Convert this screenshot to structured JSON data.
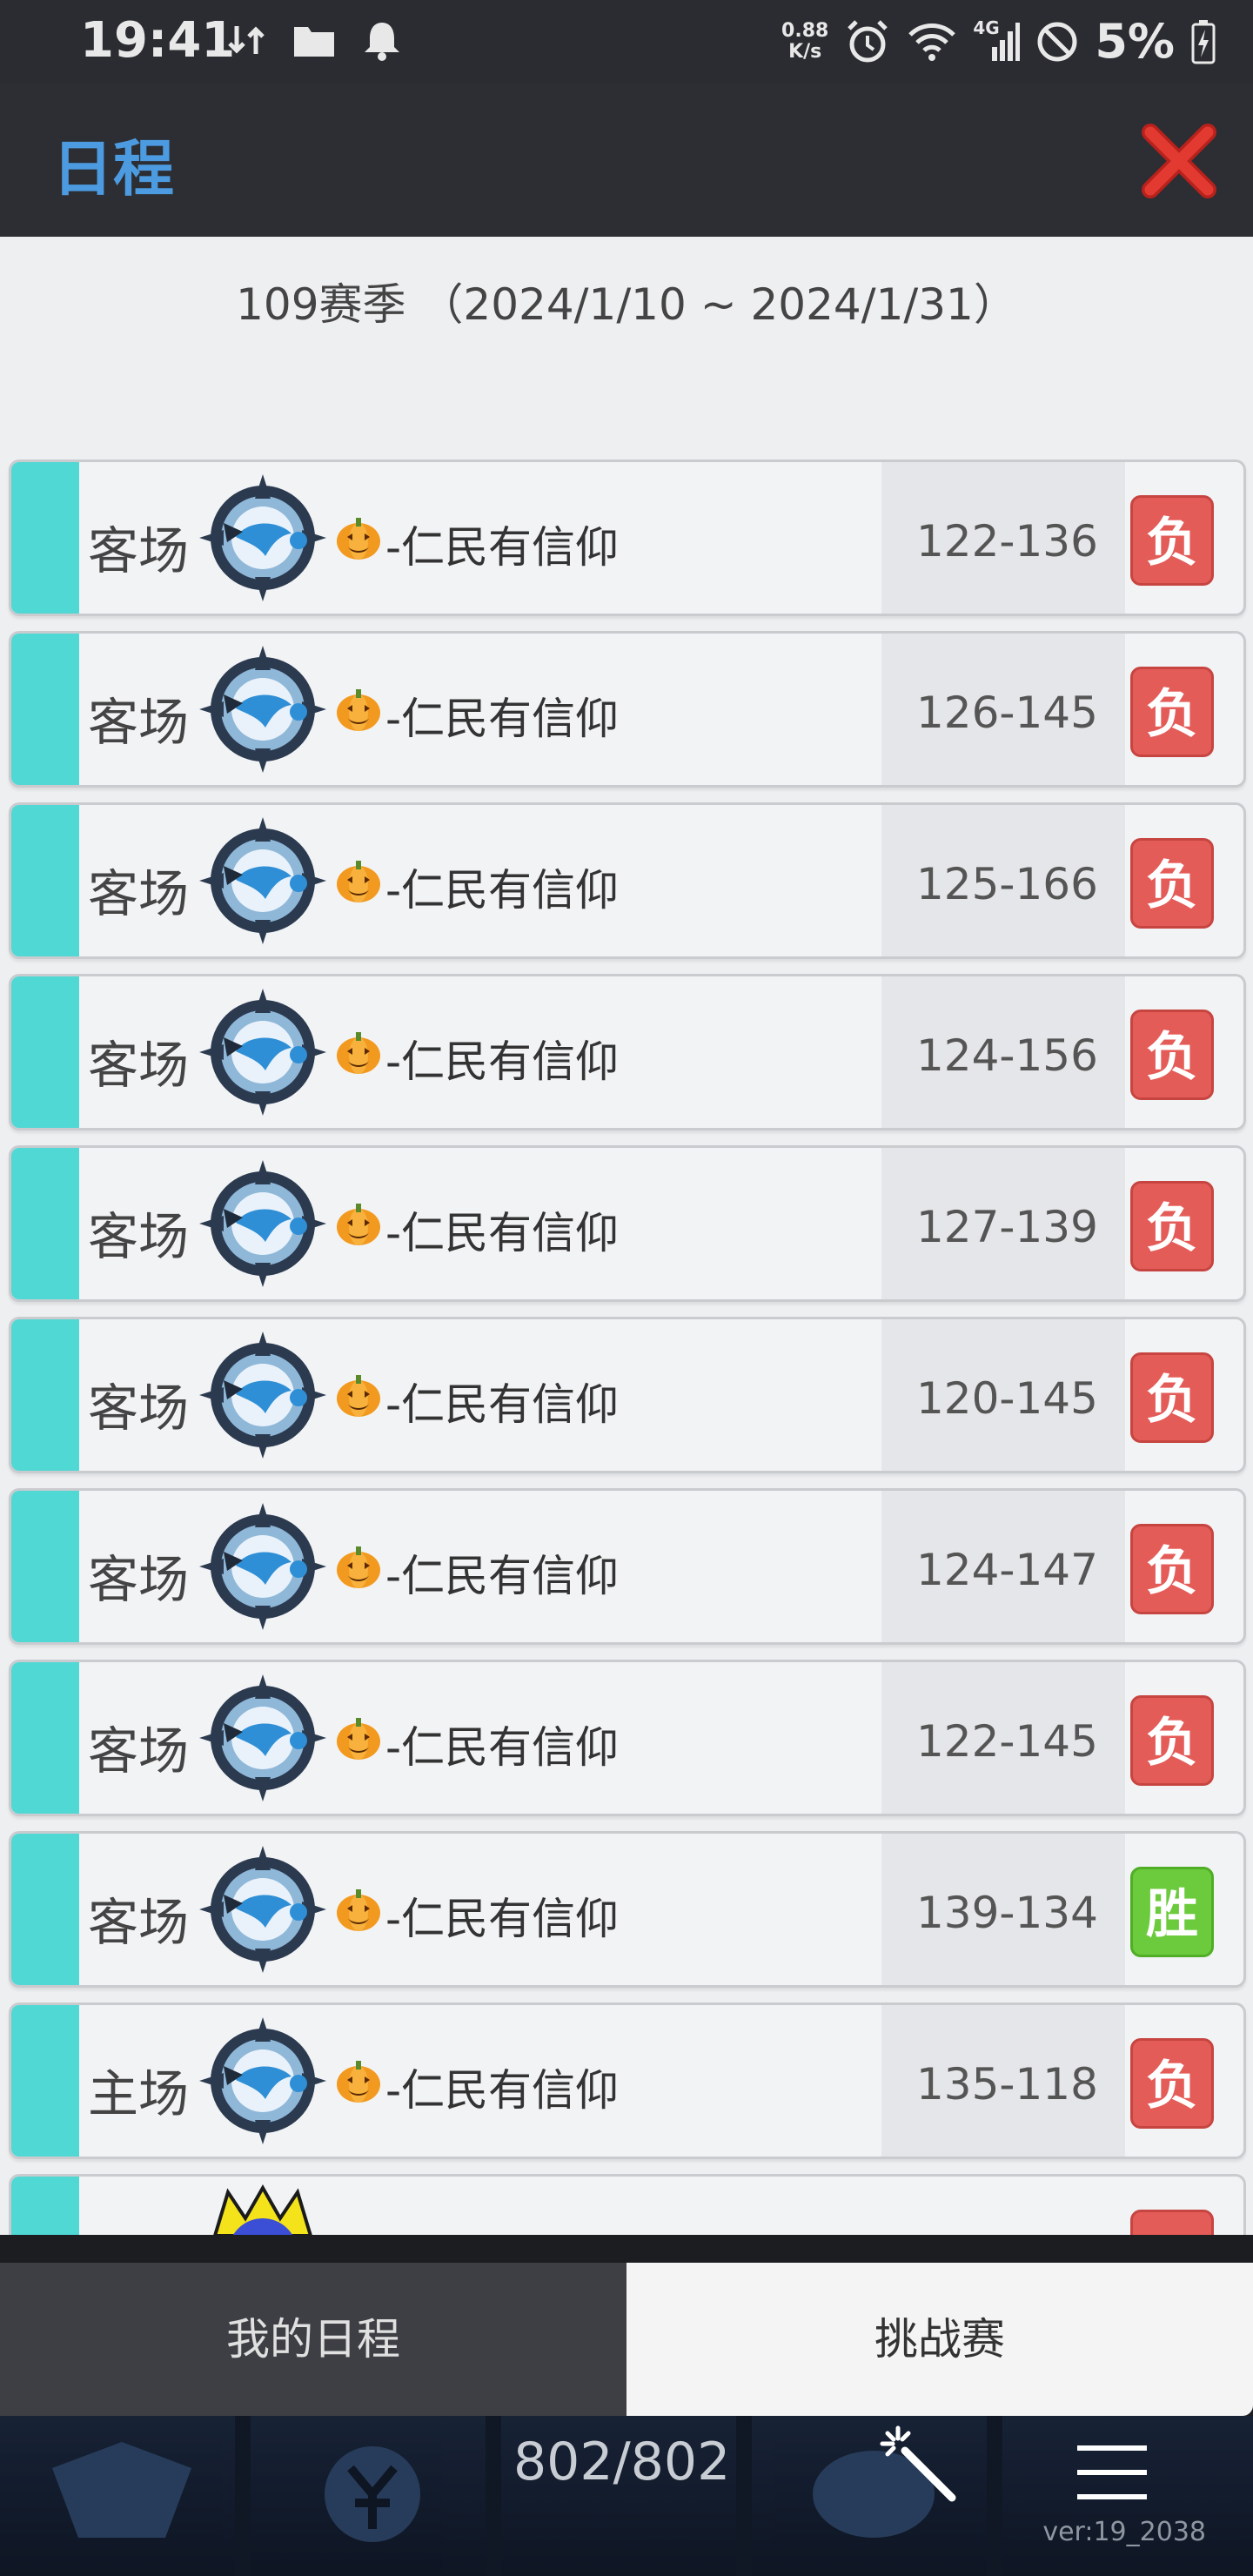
{
  "status_bar": {
    "time": "19:41",
    "net_speed_top": "0.88",
    "net_speed_bottom": "K/s",
    "network": "4G",
    "battery": "5%"
  },
  "header": {
    "title": "日程"
  },
  "season": {
    "label": "109赛季 （2024/1/10 ~ 2024/1/31）"
  },
  "games": [
    {
      "venue": "客场",
      "team": "-仁民有信仰",
      "score": "122-136",
      "result": "负"
    },
    {
      "venue": "客场",
      "team": "-仁民有信仰",
      "score": "126-145",
      "result": "负"
    },
    {
      "venue": "客场",
      "team": "-仁民有信仰",
      "score": "125-166",
      "result": "负"
    },
    {
      "venue": "客场",
      "team": "-仁民有信仰",
      "score": "124-156",
      "result": "负"
    },
    {
      "venue": "客场",
      "team": "-仁民有信仰",
      "score": "127-139",
      "result": "负"
    },
    {
      "venue": "客场",
      "team": "-仁民有信仰",
      "score": "120-145",
      "result": "负"
    },
    {
      "venue": "客场",
      "team": "-仁民有信仰",
      "score": "124-147",
      "result": "负"
    },
    {
      "venue": "客场",
      "team": "-仁民有信仰",
      "score": "122-145",
      "result": "负"
    },
    {
      "venue": "客场",
      "team": "-仁民有信仰",
      "score": "139-134",
      "result": "胜"
    },
    {
      "venue": "主场",
      "team": "-仁民有信仰",
      "score": "135-118",
      "result": "负"
    }
  ],
  "tabs": {
    "mine": "我的日程",
    "challenge": "挑战赛"
  },
  "bottom_bar": {
    "counter": "802/802",
    "version": "ver:19_2038"
  },
  "colors": {
    "accent": "#50d8d4",
    "loss": "#e45c58",
    "win": "#6ccb3c",
    "title": "#4c9be0"
  }
}
